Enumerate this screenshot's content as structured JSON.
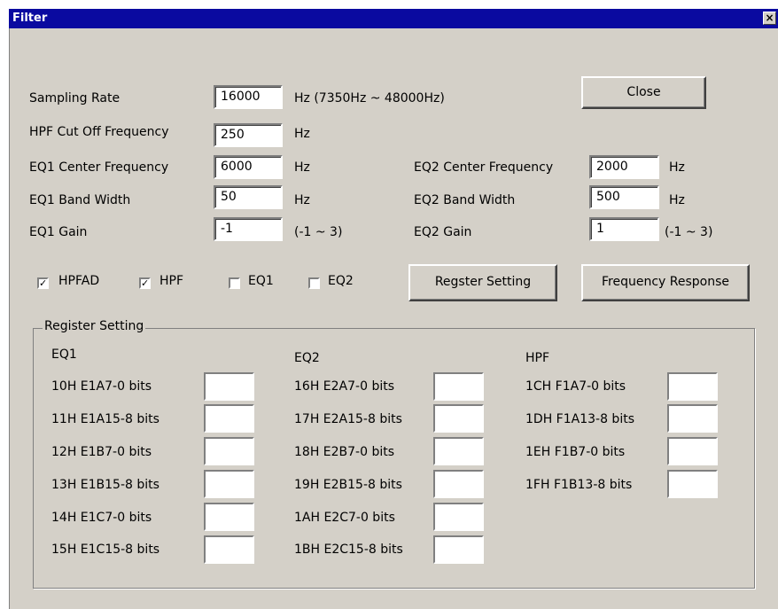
{
  "window": {
    "title": "Filter",
    "close_glyph": "×"
  },
  "params": {
    "sampling_rate": {
      "label": "Sampling Rate",
      "value": "16000",
      "unit": "Hz (7350Hz ~ 48000Hz)"
    },
    "hpf_cutoff": {
      "label": "HPF Cut Off Frequency",
      "value": "250",
      "unit": "Hz"
    },
    "eq1_center": {
      "label": "EQ1 Center Frequency",
      "value": "6000",
      "unit": "Hz"
    },
    "eq1_bandwidth": {
      "label": "EQ1 Band Width",
      "value": "50",
      "unit": "Hz"
    },
    "eq1_gain": {
      "label": "EQ1 Gain",
      "value": "-1",
      "unit": "(-1 ~ 3)"
    },
    "eq2_center": {
      "label": "EQ2 Center Frequency",
      "value": "2000",
      "unit": "Hz"
    },
    "eq2_bandwidth": {
      "label": "EQ2 Band Width",
      "value": "500",
      "unit": "Hz"
    },
    "eq2_gain": {
      "label": "EQ2 Gain",
      "value": "1",
      "unit": "(-1 ~ 3)"
    }
  },
  "buttons": {
    "close": "Close",
    "register_setting": "Regster Setting",
    "frequency_response": "Frequency Response"
  },
  "checkboxes": [
    {
      "label": "HPFAD",
      "checked": true
    },
    {
      "label": "HPF",
      "checked": true
    },
    {
      "label": "EQ1",
      "checked": false
    },
    {
      "label": "EQ2",
      "checked": false
    }
  ],
  "register": {
    "group_label": "Register Setting",
    "eq1": {
      "header": "EQ1",
      "rows": [
        "10H E1A7-0 bits",
        "11H E1A15-8 bits",
        "12H E1B7-0 bits",
        "13H E1B15-8 bits",
        "14H E1C7-0 bits",
        "15H E1C15-8 bits"
      ]
    },
    "eq2": {
      "header": "EQ2",
      "rows": [
        "16H E2A7-0 bits",
        "17H E2A15-8 bits",
        "18H E2B7-0 bits",
        "19H E2B15-8 bits",
        "1AH E2C7-0 bits",
        "1BH E2C15-8 bits"
      ]
    },
    "hpf": {
      "header": "HPF",
      "rows": [
        "1CH F1A7-0 bits",
        "1DH F1A13-8 bits",
        "1EH F1B7-0 bits",
        "1FH F1B13-8 bits"
      ]
    }
  }
}
